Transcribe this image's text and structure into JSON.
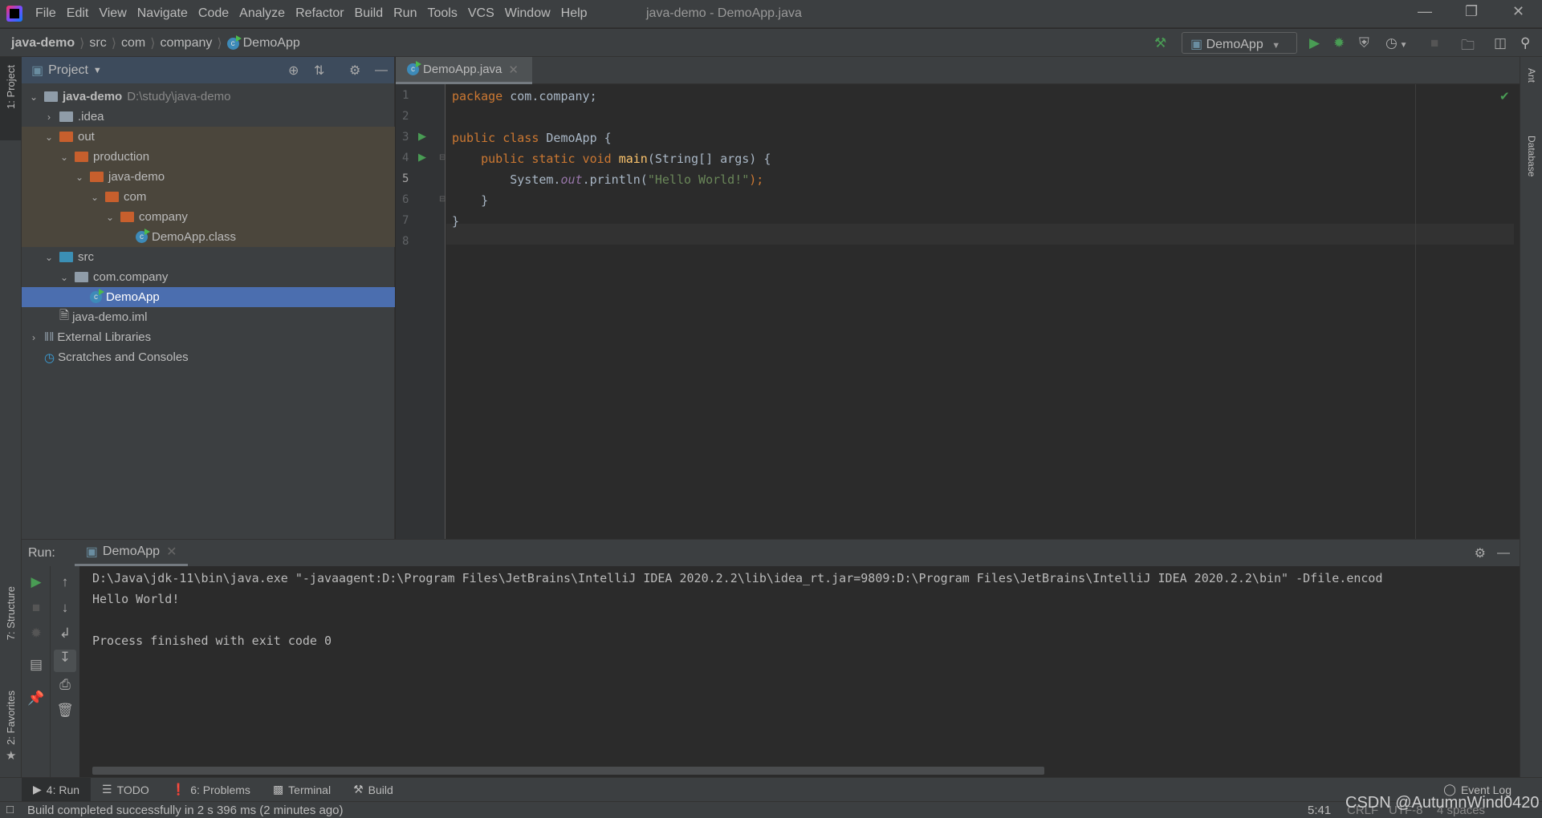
{
  "window": {
    "title": "java-demo - DemoApp.java",
    "menu": [
      "File",
      "Edit",
      "View",
      "Navigate",
      "Code",
      "Analyze",
      "Refactor",
      "Build",
      "Run",
      "Tools",
      "VCS",
      "Window",
      "Help"
    ]
  },
  "breadcrumb": [
    "java-demo",
    "src",
    "com",
    "company",
    "DemoApp"
  ],
  "toolbar": {
    "run_config": "DemoApp"
  },
  "left_stripe": {
    "project": "1: Project",
    "structure": "7: Structure",
    "favorites": "2: Favorites"
  },
  "right_stripe": {
    "ant": "Ant",
    "database": "Database"
  },
  "project": {
    "title": "Project",
    "tree": [
      {
        "label": "java-demo",
        "path": "D:\\study\\java-demo",
        "depth": 0,
        "expanded": true,
        "type": "module"
      },
      {
        "label": ".idea",
        "depth": 1,
        "expanded": false,
        "type": "folder"
      },
      {
        "label": "out",
        "depth": 1,
        "expanded": true,
        "type": "excluded"
      },
      {
        "label": "production",
        "depth": 2,
        "expanded": true,
        "type": "excluded"
      },
      {
        "label": "java-demo",
        "depth": 3,
        "expanded": true,
        "type": "excluded"
      },
      {
        "label": "com",
        "depth": 4,
        "expanded": true,
        "type": "excluded"
      },
      {
        "label": "company",
        "depth": 5,
        "expanded": true,
        "type": "excluded"
      },
      {
        "label": "DemoApp.class",
        "depth": 6,
        "type": "class-excluded"
      },
      {
        "label": "src",
        "depth": 1,
        "expanded": true,
        "type": "source"
      },
      {
        "label": "com.company",
        "depth": 2,
        "expanded": true,
        "type": "package"
      },
      {
        "label": "DemoApp",
        "depth": 3,
        "type": "class",
        "selected": true
      },
      {
        "label": "java-demo.iml",
        "depth": 1,
        "type": "iml"
      },
      {
        "label": "External Libraries",
        "depth": 0,
        "expanded": false,
        "type": "libraries"
      },
      {
        "label": "Scratches and Consoles",
        "depth": 0,
        "type": "scratches"
      }
    ]
  },
  "editor": {
    "tab": "DemoApp.java",
    "current_line": 5,
    "lines": [
      "1",
      "2",
      "3",
      "4",
      "5",
      "6",
      "7",
      "8"
    ],
    "code": {
      "l1a": "package",
      "l1b": " com.company;",
      "l3a": "public class",
      "l3b": " DemoApp {",
      "l4a": "    public static void",
      "l4b": " main",
      "l4c": "(String[] args) {",
      "l5a": "        System.",
      "l5b": "out",
      "l5c": ".println(",
      "l5d": "\"Hello World!\"",
      "l5e": ");",
      "l6": "    }",
      "l7": "}"
    }
  },
  "run": {
    "label": "Run:",
    "tab": "DemoApp",
    "output": [
      "D:\\Java\\jdk-11\\bin\\java.exe \"-javaagent:D:\\Program Files\\JetBrains\\IntelliJ IDEA 2020.2.2\\lib\\idea_rt.jar=9809:D:\\Program Files\\JetBrains\\IntelliJ IDEA 2020.2.2\\bin\" -Dfile.encod",
      "Hello World!",
      "",
      "Process finished with exit code 0"
    ]
  },
  "bottom_tabs": [
    "4: Run",
    "TODO",
    "6: Problems",
    "Terminal",
    "Build"
  ],
  "event_log": "Event Log",
  "status": {
    "message": "Build completed successfully in 2 s 396 ms (2 minutes ago)",
    "position": "5:41",
    "line_sep": "CRLF",
    "encoding": "UTF-8",
    "indent": "4 spaces"
  },
  "watermark": "CSDN @AutumnWind0420"
}
